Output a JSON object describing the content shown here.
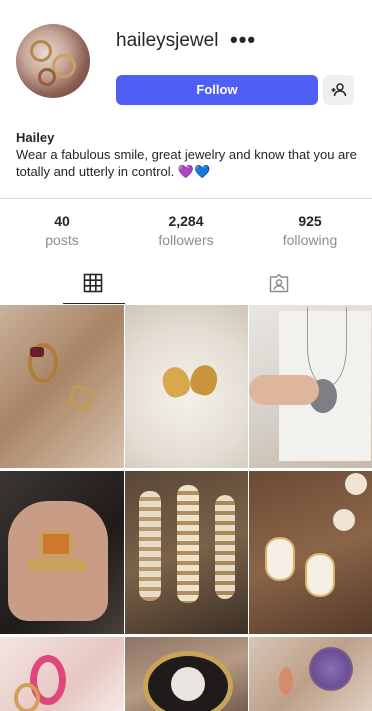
{
  "profile": {
    "username": "haileysjewel",
    "name": "Hailey",
    "bio": "Wear a fabulous smile, great jewelry and know that you are totally and utterly in control.",
    "bio_emojis": "💜💙"
  },
  "actions": {
    "follow_label": "Follow",
    "more_icon": "more-options-icon",
    "add_user_icon": "person-add-icon"
  },
  "stats": [
    {
      "value": "40",
      "label": "posts"
    },
    {
      "value": "2,284",
      "label": "followers"
    },
    {
      "value": "925",
      "label": "following"
    }
  ],
  "tabs": [
    {
      "icon": "grid-icon",
      "active": true
    },
    {
      "icon": "tagged-icon",
      "active": false
    }
  ],
  "posts": [
    {
      "subject": "gold rings on hand"
    },
    {
      "subject": "gold heart earrings on white fabric"
    },
    {
      "subject": "silver pendant necklace on card"
    },
    {
      "subject": "citrine ring on hand"
    },
    {
      "subject": "pearl dangle earrings"
    },
    {
      "subject": "floral enamel hoop earrings"
    },
    {
      "subject": "pink hoop earrings"
    },
    {
      "subject": "black enamel ring"
    },
    {
      "subject": "gemstone cocktail ring"
    }
  ],
  "colors": {
    "follow_button": "#4f5ff6",
    "muted_text": "#8e8e8e",
    "divider": "#dbdbdb"
  }
}
